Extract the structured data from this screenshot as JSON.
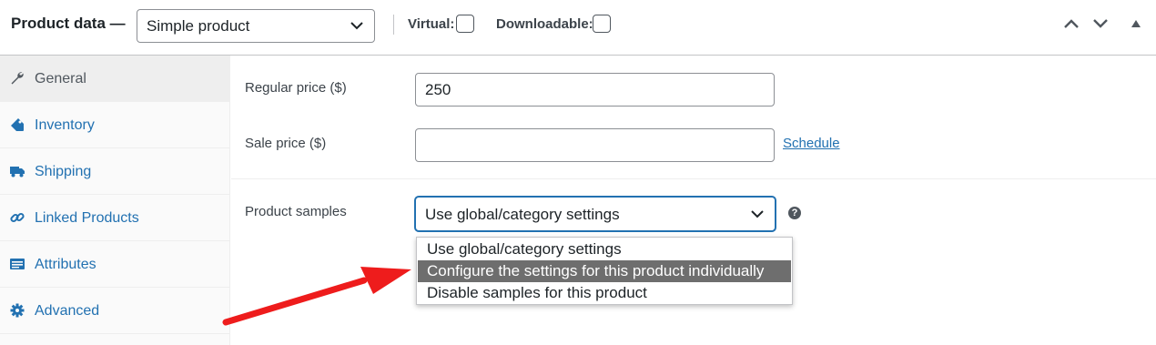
{
  "header": {
    "title": "Product data —",
    "product_type": "Simple product",
    "virtual_label": "Virtual:",
    "downloadable_label": "Downloadable:",
    "virtual_checked": false,
    "downloadable_checked": false
  },
  "sidebar": {
    "items": [
      {
        "label": "General",
        "icon": "wrench-icon",
        "active": true
      },
      {
        "label": "Inventory",
        "icon": "tag-icon",
        "active": false
      },
      {
        "label": "Shipping",
        "icon": "truck-icon",
        "active": false
      },
      {
        "label": "Linked Products",
        "icon": "link-icon",
        "active": false
      },
      {
        "label": "Attributes",
        "icon": "list-icon",
        "active": false
      },
      {
        "label": "Advanced",
        "icon": "gear-icon",
        "active": false
      }
    ]
  },
  "general": {
    "regular_price_label": "Regular price ($)",
    "regular_price_value": "250",
    "sale_price_label": "Sale price ($)",
    "sale_price_value": "",
    "schedule_link": "Schedule",
    "product_samples_label": "Product samples",
    "product_samples_value": "Use global/category settings",
    "help_icon_glyph": "?"
  },
  "dropdown": {
    "options": [
      "Use global/category settings",
      "Configure the settings for this product individually",
      "Disable samples for this product"
    ],
    "highlighted_index": 1
  },
  "colors": {
    "link": "#2271b1",
    "highlight": "#6e6e6e",
    "annotation_arrow": "#ee1c1c"
  }
}
